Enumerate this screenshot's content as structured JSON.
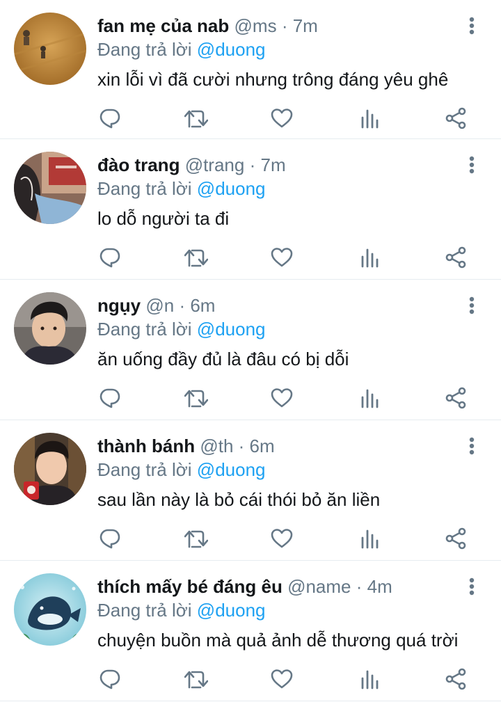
{
  "reply_prefix": "Đang trả lời",
  "icons": {
    "reply": "reply-icon",
    "retweet": "retweet-icon",
    "like": "like-icon",
    "analytics": "analytics-icon",
    "share": "share-icon",
    "more": "more-vertical-icon"
  },
  "colors": {
    "mention": "#1da1f2",
    "secondary": "#657786",
    "icon": "#657786"
  },
  "tweets": [
    {
      "name": "fan mẹ của nab",
      "handle": "@ms",
      "time": "7m",
      "reply_to": "@duong",
      "text": "xin lỗi vì đã cười nhưng trông đáng yêu ghê"
    },
    {
      "name": "đào trang",
      "handle": "@trang",
      "time": "7m",
      "reply_to": "@duong",
      "text": "lo dỗ người ta đi"
    },
    {
      "name": "ngụy",
      "handle": "@n",
      "time": "6m",
      "reply_to": "@duong",
      "text": "ăn uống đầy đủ là đâu có bị dỗi"
    },
    {
      "name": "thành bánh",
      "handle": "@th",
      "time": "6m",
      "reply_to": "@duong",
      "text": "sau lần này là bỏ cái thói bỏ ăn liền"
    },
    {
      "name": "thích mấy bé đáng êu",
      "handle": "@name",
      "time": "4m",
      "reply_to": "@duong",
      "text": "chuyện buồn mà quả ảnh dễ thương quá trời"
    }
  ]
}
